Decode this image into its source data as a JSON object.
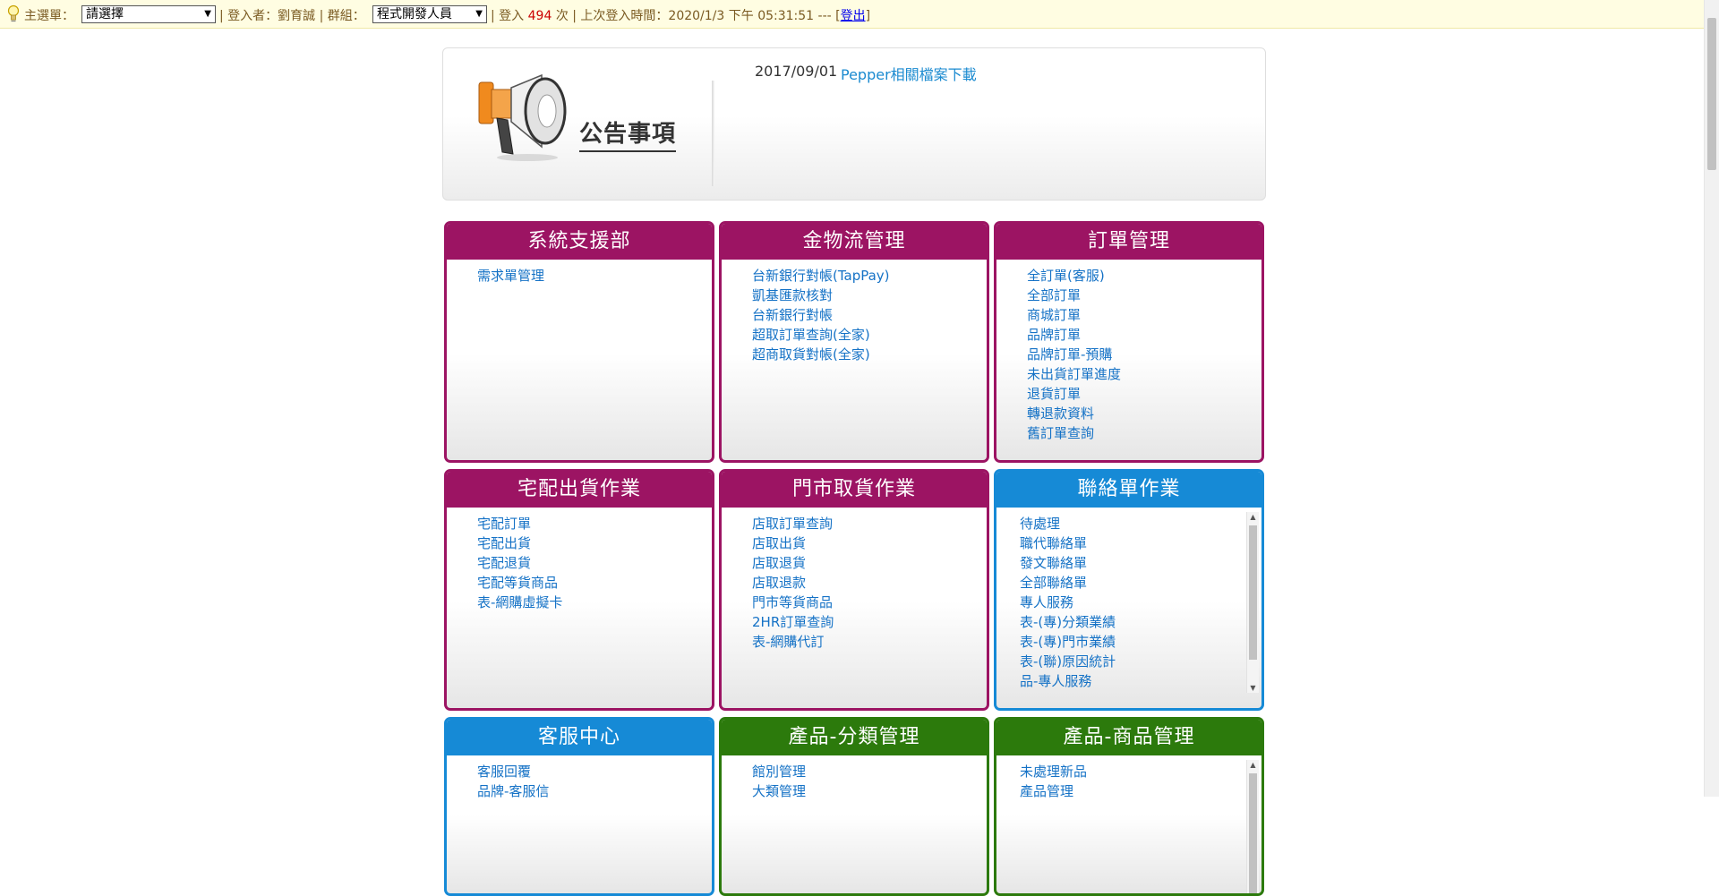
{
  "topbar": {
    "menu_label": "主選單：",
    "menu_select": "請選擇",
    "user_label": "| 登入者：劉育誠 | 群組：",
    "group_select": "程式開發人員",
    "login_prefix": "| 登入",
    "login_count": "494",
    "login_suffix": "次 | 上次登入時間：2020/1/3 下午 05:31:51 --- [",
    "logout": "登出",
    "bracket_close": "]"
  },
  "announcement": {
    "title": "公告事項",
    "items": [
      {
        "date": "2017/09/01",
        "text": "Pepper相關檔案下載"
      }
    ]
  },
  "panels": [
    {
      "title": "系統支援部",
      "color": "#9c1463",
      "items": [
        "需求單管理"
      ]
    },
    {
      "title": "金物流管理",
      "color": "#9c1463",
      "items": [
        "台新銀行對帳(TapPay)",
        "凱基匯款核對",
        "台新銀行對帳",
        "超取訂單查詢(全家)",
        "超商取貨對帳(全家)"
      ]
    },
    {
      "title": "訂單管理",
      "color": "#9c1463",
      "items": [
        "全訂單(客服)",
        "全部訂單",
        "商城訂單",
        "品牌訂單",
        "品牌訂單-預購",
        "未出貨訂單進度",
        "退貨訂單",
        "轉退款資料",
        "舊訂單查詢"
      ]
    },
    {
      "title": "宅配出貨作業",
      "color": "#9c1463",
      "items": [
        "宅配訂單",
        "宅配出貨",
        "宅配退貨",
        "宅配等貨商品",
        "表-網購虛擬卡"
      ]
    },
    {
      "title": "門市取貨作業",
      "color": "#9c1463",
      "items": [
        "店取訂單查詢",
        "店取出貨",
        "店取退貨",
        "店取退款",
        "門市等貨商品",
        "2HR訂單查詢",
        "表-網購代訂"
      ]
    },
    {
      "title": "聯絡單作業",
      "color": "#168ad6",
      "items": [
        "待處理",
        "職代聯絡單",
        "發文聯絡單",
        "全部聯絡單",
        "專人服務",
        "表-(專)分類業績",
        "表-(專)門市業績",
        "表-(聯)原因統計",
        "品-專人服務"
      ]
    },
    {
      "title": "客服中心",
      "color": "#168ad6",
      "items": [
        "客服回覆",
        "品牌-客服信"
      ]
    },
    {
      "title": "產品-分類管理",
      "color": "#2c7a0c",
      "items": [
        "館別管理",
        "大類管理"
      ]
    },
    {
      "title": "產品-商品管理",
      "color": "#2c7a0c",
      "items": [
        "未處理新品",
        "產品管理"
      ]
    }
  ]
}
